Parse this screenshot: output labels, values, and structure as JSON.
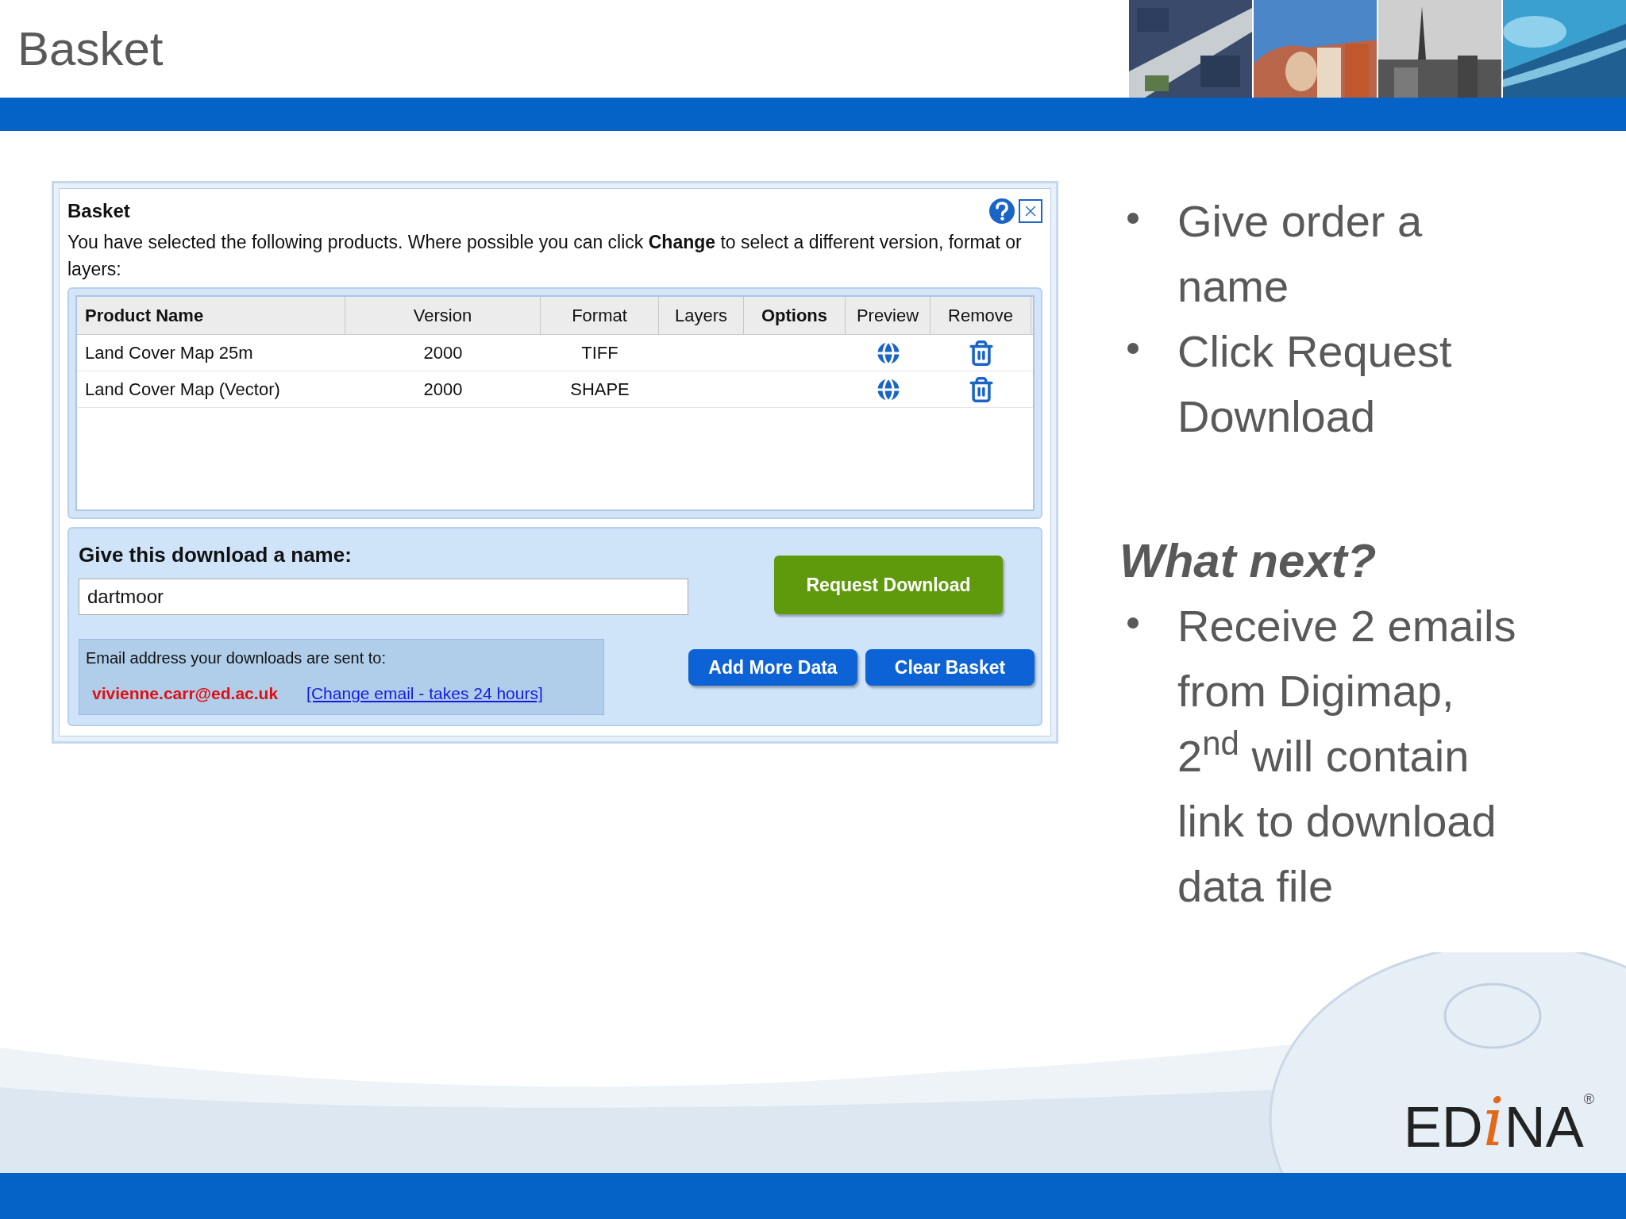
{
  "slide": {
    "title": "Basket"
  },
  "dialog": {
    "title": "Basket",
    "intro": "You have selected the following products. Where possible you can click **Change** to select a different version, format or layers:",
    "table": {
      "columns": [
        {
          "label": "Product Name",
          "bold": true
        },
        {
          "label": "Version",
          "bold": false
        },
        {
          "label": "Format",
          "bold": false
        },
        {
          "label": "Layers",
          "bold": false
        },
        {
          "label": "Options",
          "bold": true
        },
        {
          "label": "Preview",
          "bold": false
        },
        {
          "label": "Remove",
          "bold": false
        }
      ],
      "rows": [
        {
          "product_name": "Land Cover Map 25m",
          "version": "2000",
          "format": "TIFF"
        },
        {
          "product_name": "Land Cover Map (Vector)",
          "version": "2000",
          "format": "SHAPE"
        }
      ]
    },
    "name_label": "Give this download a name:",
    "name_value": "dartmoor",
    "request_button": "Request Download",
    "email_label": "Email address your downloads are sent to:",
    "email": "vivienne.carr@ed.ac.uk",
    "change_email_link": "[Change email - takes 24 hours]",
    "buttons": [
      "Add More Data",
      "Clear Basket"
    ]
  },
  "bullets": [
    "Give order a name",
    "Click Request Download"
  ],
  "heading": "What next?",
  "next_bullets": [
    "Receive 2 emails from Digimap, 2$^{nd}$ will contain link to download data file"
  ],
  "logo": {
    "parts": [
      "ED",
      "i",
      "NA"
    ],
    "mark": "®"
  }
}
